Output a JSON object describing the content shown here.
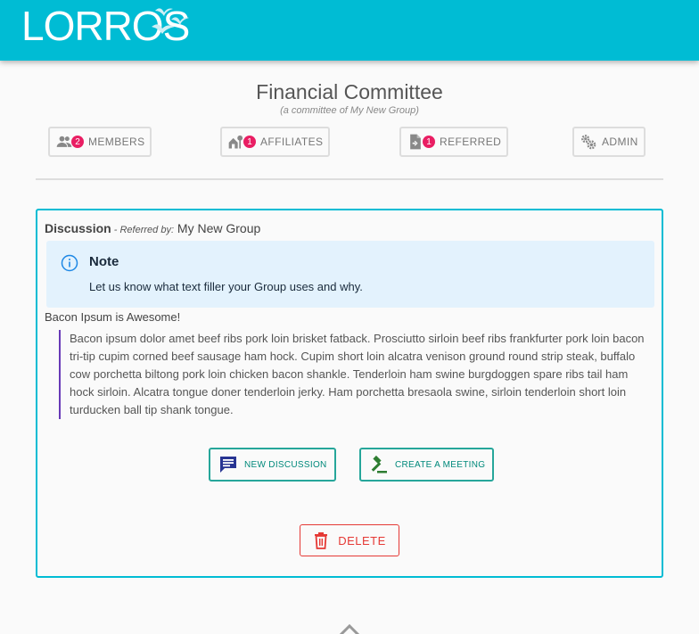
{
  "header": {
    "logo_text": "LORROS"
  },
  "page": {
    "title": "Financial Committee",
    "subtitle": "(a committee of My New Group)"
  },
  "tabs": [
    {
      "label": "MEMBERS",
      "badge": "2",
      "icon": "people-icon"
    },
    {
      "label": "AFFILIATES",
      "badge": "1",
      "icon": "house-tree-icon"
    },
    {
      "label": "REFERRED",
      "badge": "1",
      "icon": "document-icon"
    },
    {
      "label": "ADMIN",
      "badge": "",
      "icon": "gears-icon"
    }
  ],
  "discussion": {
    "heading": "Discussion",
    "separator": " - ",
    "referred_label": "Referred by:",
    "referred_group": "My New Group",
    "note_title": "Note",
    "note_body": "Let us know what text filler your Group uses and why.",
    "post_title": "Bacon Ipsum is Awesome!",
    "post_body": "Bacon ipsum dolor amet beef ribs pork loin brisket fatback. Prosciutto sirloin beef ribs frankfurter pork loin bacon tri-tip cupim corned beef sausage ham hock. Cupim short loin alcatra venison ground round strip steak, buffalo cow porchetta biltong pork loin chicken bacon shankle. Tenderloin ham swine burgdoggen spare ribs tail ham hock sirloin. Alcatra tongue doner tenderloin jerky. Ham porchetta bresaola swine, sirloin tenderloin short loin turducken ball tip shank tongue."
  },
  "actions": {
    "new_discussion": "NEW DISCUSSION",
    "create_meeting": "CREATE A MEETING",
    "delete": "DELETE"
  },
  "colors": {
    "accent": "#00bcd4",
    "badge": "#e91e63",
    "action": "#26a69a",
    "danger": "#e53935",
    "quote_border": "#673ab7"
  }
}
